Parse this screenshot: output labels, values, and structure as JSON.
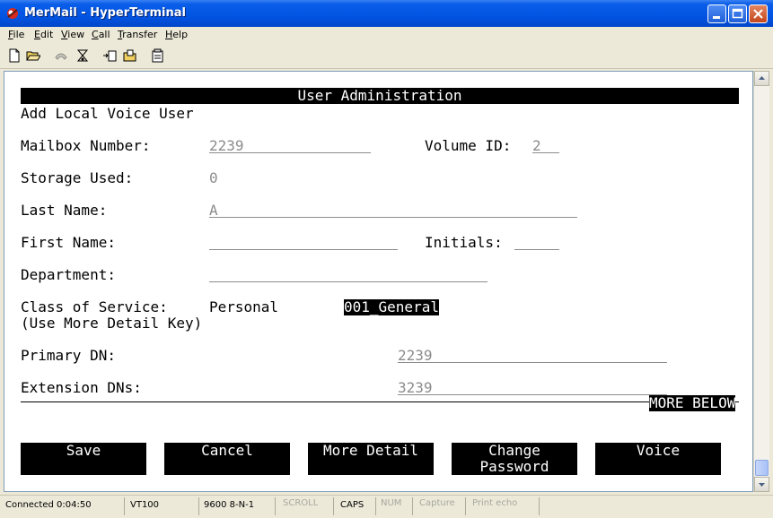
{
  "window": {
    "title": "MerMail - HyperTerminal"
  },
  "menu": [
    {
      "accel": "F",
      "rest": "ile"
    },
    {
      "accel": "E",
      "rest": "dit"
    },
    {
      "accel": "V",
      "rest": "iew"
    },
    {
      "accel": "C",
      "rest": "all"
    },
    {
      "accel": "T",
      "rest": "ransfer"
    },
    {
      "accel": "H",
      "rest": "elp"
    }
  ],
  "toolbar_icons": [
    "new-connection-icon",
    "open-icon",
    "disconnect-icon",
    "dial-icon",
    "send-file-icon",
    "receive-file-icon",
    "properties-icon"
  ],
  "screen": {
    "header": "User Administration",
    "subtitle": "Add Local Voice User",
    "mailbox_label": "Mailbox Number:",
    "mailbox_value": "2239",
    "volume_label": "Volume ID:",
    "volume_value": "2",
    "storage_label": "Storage Used:",
    "storage_value": "0",
    "last_name_label": "Last Name:",
    "last_name_value": "A",
    "first_name_label": "First Name:",
    "initials_label": "Initials:",
    "department_label": "Department:",
    "cos_label": "Class of Service:",
    "cos_hint": "(Use More Detail Key)",
    "cos_type": "Personal",
    "cos_value": "001_General",
    "primary_dn_label": "Primary DN:",
    "primary_dn_value": "2239",
    "ext_dn_label": "Extension DNs:",
    "ext_dn_value": "3239",
    "more_below": "MORE BELOW",
    "softkeys": [
      "Save",
      "Cancel",
      "More Detail",
      "Change\nPassword",
      "Voice"
    ]
  },
  "status": {
    "connected": "Connected 0:04:50",
    "emulation": "VT100",
    "settings": "9600 8-N-1",
    "scroll": "SCROLL",
    "caps": "CAPS",
    "num": "NUM",
    "capture": "Capture",
    "print_echo": "Print echo"
  }
}
